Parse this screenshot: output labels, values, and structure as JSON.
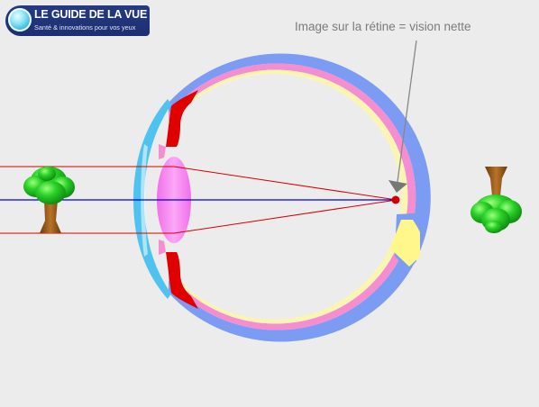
{
  "logo": {
    "title": "LE GUIDE DE LA VUE",
    "tagline": "Santé & innovations pour vos yeux"
  },
  "annotation": {
    "text": "Image sur la rétine = vision nette"
  },
  "colors": {
    "background": "#ececec",
    "sclera": "#7b9cf2",
    "retina": "#f48ed1",
    "choroid": "#fbf5b3",
    "cornea": "#4fc3f0",
    "lens": "#f58cf0",
    "ciliary_body": "#e00000",
    "optic_nerve": "#fff78a",
    "light_ray": "#d80000",
    "optical_axis": "#0000e0",
    "focus_point": "#d00000",
    "tree_foliage": "#1fc81f",
    "tree_trunk": "#9a5b14",
    "pointer": "#888888"
  }
}
